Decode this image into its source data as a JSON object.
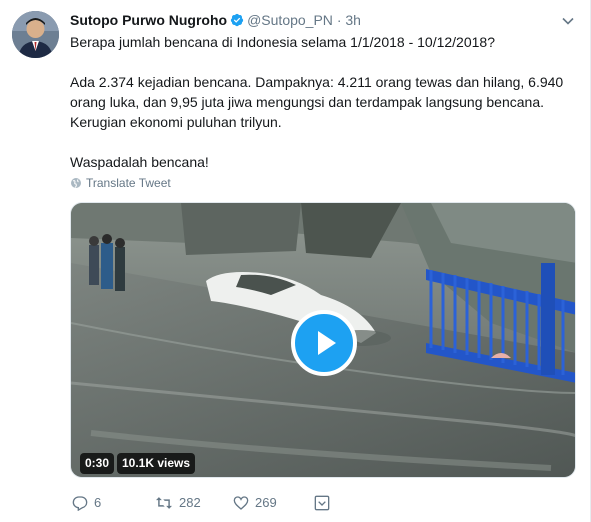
{
  "tweet": {
    "author_name": "Sutopo Purwo Nugroho",
    "handle": "@Sutopo_PN",
    "separator": "·",
    "time": "3h",
    "lines": [
      "Berapa jumlah bencana di Indonesia selama 1/1/2018 - 10/12/2018?",
      "Ada 2.374 kejadian bencana. Dampaknya: 4.211 orang tewas dan hilang, 6.940",
      "orang luka, dan 9,95 juta jiwa mengungsi dan terdampak langsung bencana.",
      "Kerugian ekonomi puluhan trilyun.",
      "Waspadalah bencana!"
    ],
    "translate_label": "Translate Tweet"
  },
  "video": {
    "duration": "0:30",
    "views": "10.1K views"
  },
  "actions": {
    "replies": "6",
    "retweets": "282",
    "likes": "269"
  },
  "colors": {
    "accent": "#1da1f2",
    "muted": "#657786"
  },
  "icons": [
    "verified-badge-icon",
    "chevron-down-icon",
    "globe-icon",
    "play-icon",
    "reply-icon",
    "retweet-icon",
    "like-icon",
    "share-icon"
  ]
}
